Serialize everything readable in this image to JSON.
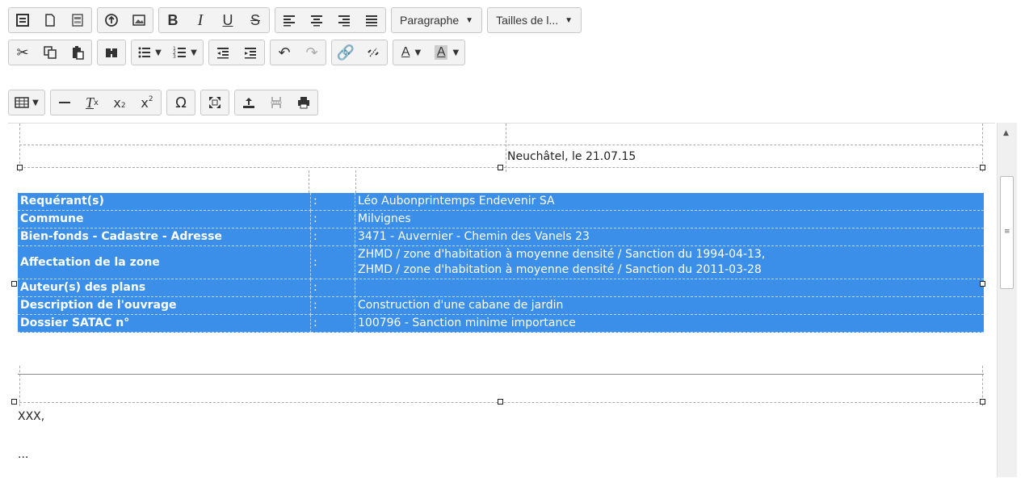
{
  "toolbar": {
    "format_dropdown": "Paragraphe",
    "size_dropdown": "Tailles de l...",
    "icons_row1": [
      "source-icon",
      "new-page-icon",
      "templates-icon",
      "upload-icon",
      "image-icon",
      "bold-icon",
      "italic-icon",
      "underline-icon",
      "strike-icon",
      "align-left-icon",
      "align-center-icon",
      "align-right-icon",
      "justify-icon"
    ],
    "icons_row2": [
      "cut-icon",
      "copy-icon",
      "paste-icon",
      "find-icon",
      "bulleted-list-icon",
      "numbered-list-icon",
      "outdent-icon",
      "indent-icon",
      "undo-icon",
      "redo-icon",
      "link-icon",
      "unlink-icon",
      "text-color-icon",
      "background-color-icon"
    ],
    "icons_row3": [
      "table-icon",
      "horizontal-rule-icon",
      "remove-format-icon",
      "subscript-icon",
      "superscript-icon",
      "special-char-icon",
      "maximize-icon",
      "upload-icon",
      "page-break-icon",
      "print-icon"
    ]
  },
  "document": {
    "date_line": "Neuchâtel, le 21.07.15",
    "rows": [
      {
        "label": "Requérant(s)",
        "sep": ":",
        "value": "Léo Aubonprintemps Endevenir SA"
      },
      {
        "label": "Commune",
        "sep": ":",
        "value": "Milvignes"
      },
      {
        "label": "Bien-fonds - Cadastre - Adresse",
        "sep": ":",
        "value": "3471 - Auvernier - Chemin des Vanels 23"
      },
      {
        "label": "Affectation de la zone",
        "sep": ":",
        "value": "ZHMD / zone d'habitation à moyenne densité / Sanction du 1994-04-13,",
        "value2": "ZHMD / zone d'habitation à moyenne densité / Sanction du 2011-03-28"
      },
      {
        "label": "Auteur(s) des plans",
        "sep": ":",
        "value": ""
      },
      {
        "label": "Description de l'ouvrage",
        "sep": ":",
        "value": "Construction d'une cabane de jardin"
      },
      {
        "label": "Dossier SATAC n°",
        "sep": ":",
        "value": "100796 - Sanction minime importance"
      }
    ],
    "para1": "XXX,",
    "para2": "..."
  },
  "colors": {
    "selection": "#3b8fe8"
  }
}
